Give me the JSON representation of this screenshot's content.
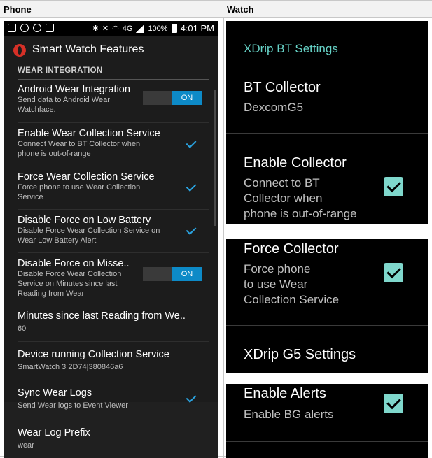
{
  "columns": {
    "phone": "Phone",
    "watch": "Watch"
  },
  "phone": {
    "status_bar": {
      "network": "4G",
      "battery": "100%",
      "time": "4:01 PM"
    },
    "app_title": "Smart Watch Features",
    "section": "WEAR INTEGRATION",
    "prefs": [
      {
        "title": "Android Wear Integration",
        "summary": "Send data to Android Wear Watchface.",
        "widget": "toggle",
        "value": "ON"
      },
      {
        "title": "Enable Wear Collection Service",
        "summary": "Connect Wear to BT Collector when phone is out-of-range",
        "widget": "checkbox",
        "checked": true
      },
      {
        "title": "Force Wear Collection Service",
        "summary": "Force phone to use Wear Collection Service",
        "widget": "checkbox",
        "checked": true
      },
      {
        "title": "Disable Force on Low Battery",
        "summary": "Disable Force Wear Collection Service on Wear Low Battery Alert",
        "widget": "checkbox",
        "checked": true
      },
      {
        "title": "Disable Force on Misse..",
        "summary": "Disable Force Wear Collection Service on Minutes since last Reading from Wear",
        "widget": "toggle",
        "value": "ON"
      },
      {
        "title": "Minutes since last Reading from We..",
        "summary": "60"
      },
      {
        "title": "Device running Collection Service",
        "summary": "SmartWatch 3 2D74|380846a6"
      },
      {
        "title": "Sync Wear Logs",
        "summary": "Send Wear logs to Event Viewer",
        "widget": "checkbox",
        "checked": true
      },
      {
        "title": "Wear Log Prefix",
        "summary": "wear"
      }
    ]
  },
  "watch": {
    "panel1": {
      "header": "XDrip BT Settings",
      "collector_title": "BT Collector",
      "collector_value": "DexcomG5",
      "enable_title": "Enable Collector",
      "enable_summary_1": "Connect to BT",
      "enable_summary_2": "Collector when",
      "enable_summary_3": "phone is out-of-range",
      "enable_checked": true
    },
    "panel2": {
      "force_title": "Force Collector",
      "force_summary_1": "Force phone",
      "force_summary_2": "to use Wear",
      "force_summary_3": "Collection Service",
      "force_checked": true,
      "g5_title": "XDrip G5 Settings"
    },
    "panel3": {
      "alerts_title": "Enable Alerts",
      "alerts_summary": "Enable BG alerts",
      "alerts_checked": true
    }
  }
}
